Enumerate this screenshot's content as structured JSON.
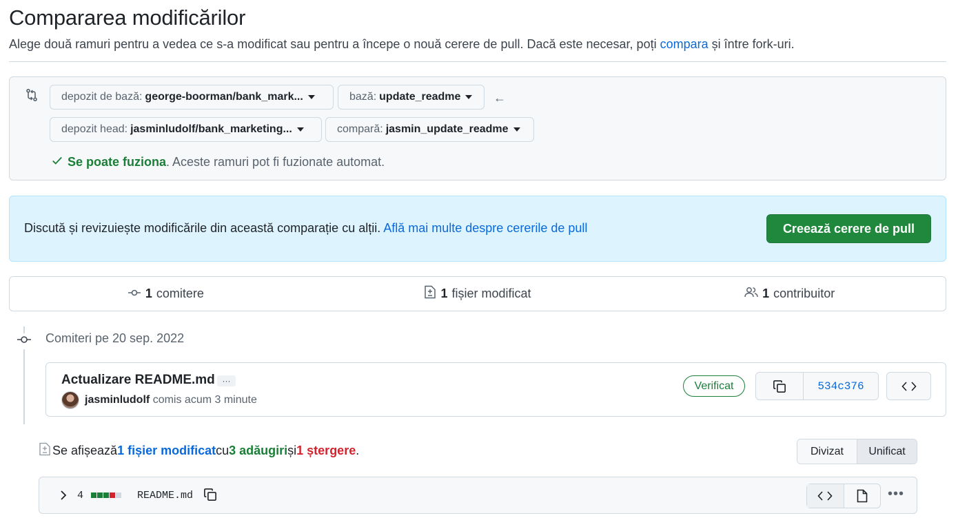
{
  "header": {
    "title": "Compararea modificărilor",
    "subtitle_before": "Alege două ramuri pentru a vedea ce s-a modificat sau pentru a începe o nouă cerere de pull. Dacă este necesar, poți ",
    "subtitle_link": "compara",
    "subtitle_after": " și între fork-uri."
  },
  "range": {
    "icon": "git-compare-icon",
    "base_repo": {
      "label": "depozit de bază:",
      "value": "george-boorman/bank_mark..."
    },
    "base": {
      "label": "bază:",
      "value": "update_readme"
    },
    "head_repo": {
      "label": "depozit head:",
      "value": "jasminludolf/bank_marketing..."
    },
    "compare": {
      "label": "compară:",
      "value": "jasmin_update_readme"
    },
    "arrow": "←",
    "merge_ok": "Se poate fuziona",
    "merge_rest": ". Aceste ramuri pot fi fuzionate automat."
  },
  "flash": {
    "text": "Discută și revizuiește modificările din această comparație cu alții. ",
    "link": "Află mai multe despre cererile de pull",
    "button": "Creează cerere de pull"
  },
  "summary": {
    "commits_count": "1",
    "commits_label": "comitere",
    "files_count": "1",
    "files_label": "fișier modificat",
    "contributors_count": "1",
    "contributors_label": "contribuitor"
  },
  "timeline": {
    "date_label": "Comiteri pe 20 sep. 2022"
  },
  "commit": {
    "title": "Actualizare README.md",
    "ellipsis": "···",
    "author": "jasminludolf",
    "time": "comis acum 3 minute",
    "verified": "Verificat",
    "sha": "534c376"
  },
  "toc": {
    "prefix": "Se afișează ",
    "files": "1 fișier modificat",
    "with": " cu ",
    "additions": "3 adăugiri",
    "and": " și ",
    "deletions": "1 ștergere",
    "end": ".",
    "split": "Divizat",
    "unified": "Unificat"
  },
  "file": {
    "changes": "4",
    "name": "README.md",
    "diffstat": {
      "additions": 3,
      "deletions": 1,
      "neutral": 1
    },
    "colors": {
      "add": "#1a7f37",
      "del": "#d1242f",
      "neutral": "#d1d9e0"
    }
  },
  "colors": {
    "link": "#0969da",
    "success": "#1a7f37",
    "danger": "#d1242f",
    "primary_button": "#1f883d"
  }
}
